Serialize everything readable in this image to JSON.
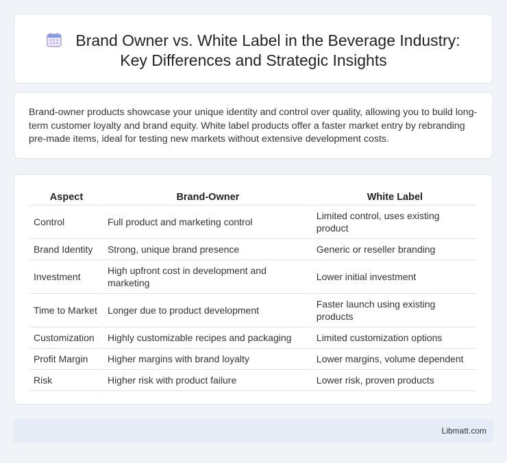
{
  "header": {
    "title_line1": "Brand Owner vs. White Label in the Beverage Industry:",
    "title_line2": "Key Differences and Strategic Insights",
    "icon": "calendar-icon"
  },
  "intro": {
    "text": "Brand-owner products showcase your unique identity and control over quality, allowing you to build long-term customer loyalty and brand equity. White label products offer a faster market entry by rebranding pre-made items, ideal for testing new markets without extensive development costs."
  },
  "table": {
    "headers": [
      "Aspect",
      "Brand-Owner",
      "White Label"
    ],
    "rows": [
      [
        "Control",
        "Full product and marketing control",
        "Limited control, uses existing product"
      ],
      [
        "Brand Identity",
        "Strong, unique brand presence",
        "Generic or reseller branding"
      ],
      [
        "Investment",
        "High upfront cost in development and marketing",
        "Lower initial investment"
      ],
      [
        "Time to Market",
        "Longer due to product development",
        "Faster launch using existing products"
      ],
      [
        "Customization",
        "Highly customizable recipes and packaging",
        "Limited customization options"
      ],
      [
        "Profit Margin",
        "Higher margins with brand loyalty",
        "Lower margins, volume dependent"
      ],
      [
        "Risk",
        "Higher risk with product failure",
        "Lower risk, proven products"
      ]
    ]
  },
  "footer": {
    "site": "Libmatt.com"
  },
  "colors": {
    "background": "#f0f3f7",
    "footer_bg": "#e6ecf5",
    "icon_accent": "#8e7cc3"
  }
}
